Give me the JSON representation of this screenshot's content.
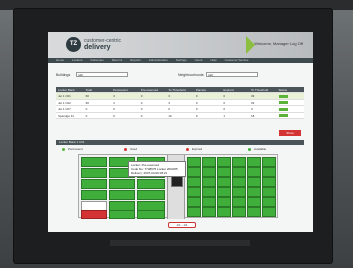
{
  "header": {
    "logo_text": "TZ",
    "brand_line1": "customer-centric",
    "brand_line2": "delivery",
    "welcome": "Welcome, Manager  Log Off"
  },
  "nav": {
    "items": [
      "Home",
      "Lockers",
      "Deliveries",
      "Returns",
      "Reports",
      "Administration",
      "Settings",
      "Users",
      "Help",
      "Customer Service"
    ]
  },
  "filters": {
    "building_label": "Buildings",
    "building_value": "(all)",
    "neighbourhoods_label": "Neighbourhoods",
    "neighbourhoods_value": "(all)"
  },
  "table": {
    "headers": [
      "Locker Bank",
      "Total",
      "Permanent",
      "Pre-reserved",
      "To Threshold",
      "Parcels",
      "Expired",
      "To Threshold",
      "Status"
    ],
    "rows": [
      [
        "Jet 1 C01",
        "60",
        "3",
        "0",
        "3",
        "0",
        "0",
        "33",
        ""
      ],
      [
        "Jet 1 C02",
        "60",
        "3",
        "0",
        "3",
        "0",
        "0",
        "33",
        ""
      ],
      [
        "Jet 1 C07",
        "0",
        "0",
        "0",
        "0",
        "0",
        "0",
        "0",
        ""
      ],
      [
        "Spandge Fx",
        "0",
        "0",
        "0",
        "10",
        "0",
        "1",
        "18",
        ""
      ]
    ]
  },
  "action_button": "Show",
  "locker_section": {
    "title": "Locker Bank 1 C01",
    "legend": [
      {
        "label": "Permanent",
        "color": "#5cb33a"
      },
      {
        "label": "Used",
        "color": "#d43333"
      },
      {
        "label": "Expired",
        "color": "#d43333"
      },
      {
        "label": "Available",
        "color": "#3fae3a"
      }
    ]
  },
  "tooltip": {
    "line1": "Locker: Pre-reserved",
    "line2": "Code No: 7748975  Locker 2004/05",
    "line3": "Delivery: 2007-03-09 08:21"
  },
  "pager": "1/1 - 1/1",
  "colors": {
    "available": "#3fae3a",
    "used": "#d43333",
    "header_dark": "#4b5559",
    "accent_green": "#8cbf3f"
  }
}
